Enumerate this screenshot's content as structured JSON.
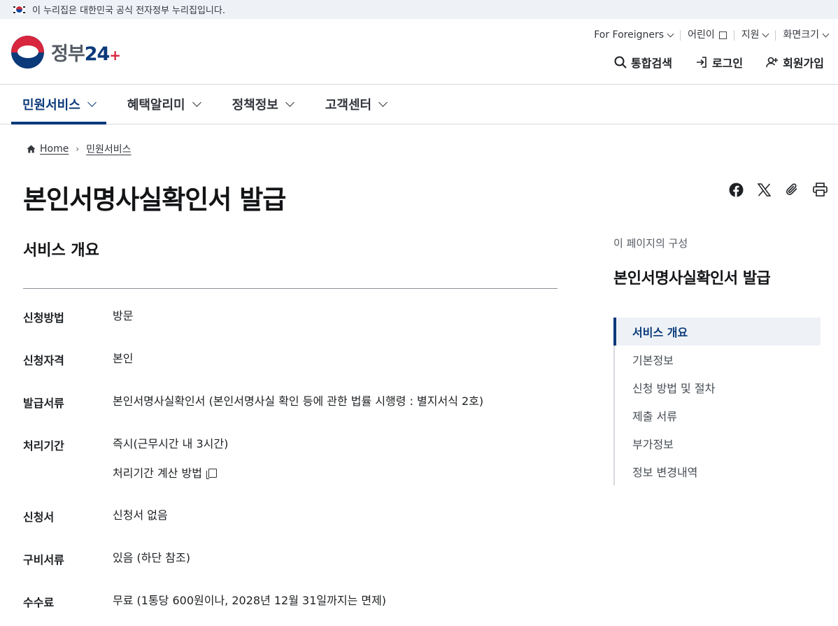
{
  "banner": {
    "text": "이 누리집은 대한민국 공식 전자정부 누리집입니다."
  },
  "logo": {
    "text": "정부",
    "num": "24"
  },
  "util_nav": [
    {
      "label": "For Foreigners"
    },
    {
      "label": "어린이"
    },
    {
      "label": "지원"
    },
    {
      "label": "화면크기"
    }
  ],
  "actions": {
    "search": "통합검색",
    "login": "로그인",
    "signup": "회원가입"
  },
  "main_nav": [
    {
      "label": "민원서비스"
    },
    {
      "label": "혜택알리미"
    },
    {
      "label": "정책정보"
    },
    {
      "label": "고객센터"
    }
  ],
  "breadcrumb": {
    "home": "Home",
    "current": "민원서비스"
  },
  "page": {
    "title": "본인서명사실확인서 발급"
  },
  "section": {
    "title": "서비스 개요"
  },
  "info": [
    {
      "label": "신청방법",
      "value": "방문"
    },
    {
      "label": "신청자격",
      "value": "본인"
    },
    {
      "label": "발급서류",
      "value": "본인서명사실확인서 (본인서명사실 확인 등에 관한 법률 시행령 : 별지서식 2호)"
    },
    {
      "label": "처리기간",
      "value": "즉시(근무시간 내 3시간)",
      "sub": "처리기간 계산 방법"
    },
    {
      "label": "신청서",
      "value": "신청서 없음"
    },
    {
      "label": "구비서류",
      "value": "있음 (하단 참조)"
    },
    {
      "label": "수수료",
      "value": "무료 (1통당 600원이나, 2028년 12월 31일까지는 면제)"
    }
  ],
  "toc": {
    "caption": "이 페이지의 구성",
    "title": "본인서명사실확인서 발급",
    "items": [
      {
        "label": "서비스 개요"
      },
      {
        "label": "기본정보"
      },
      {
        "label": "신청 방법 및 절차"
      },
      {
        "label": "제출 서류"
      },
      {
        "label": "부가정보"
      },
      {
        "label": "정보 변경내역"
      }
    ]
  },
  "colors": {
    "primary": "#0b3a7a",
    "accent": "#d7263d",
    "banner_bg": "#eef2f7"
  }
}
